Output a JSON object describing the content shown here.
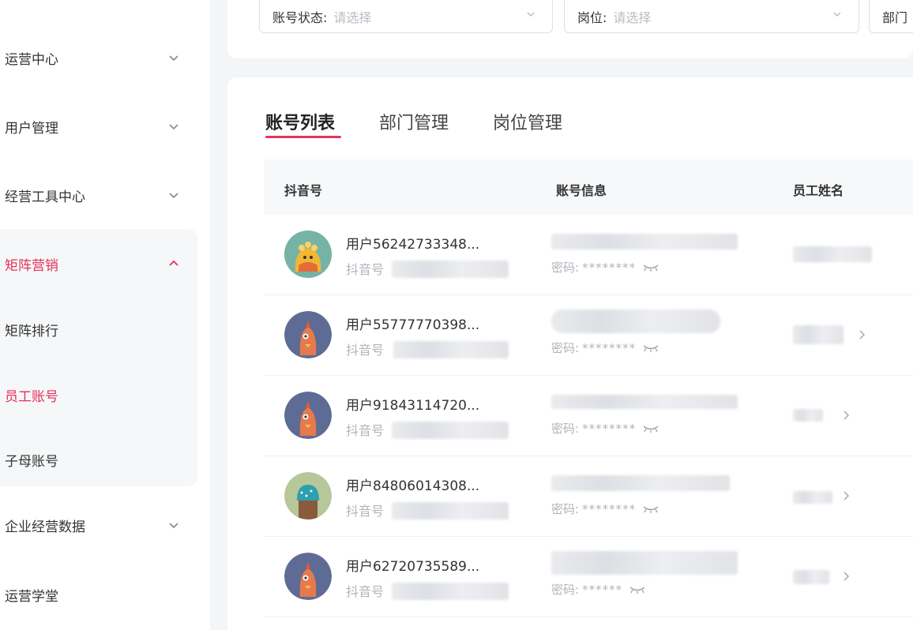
{
  "sidebar": {
    "items": [
      {
        "label": "运营中心"
      },
      {
        "label": "用户管理"
      },
      {
        "label": "经营工具中心"
      },
      {
        "label": "矩阵营销"
      },
      {
        "label": "矩阵排行"
      },
      {
        "label": "员工账号"
      },
      {
        "label": "子母账号"
      },
      {
        "label": "企业经营数据"
      },
      {
        "label": "运营学堂"
      }
    ]
  },
  "filters": {
    "account_status": {
      "label": "账号状态:",
      "placeholder": "请选择"
    },
    "position": {
      "label": "岗位:",
      "placeholder": "请选择"
    },
    "department": {
      "label": "部门"
    }
  },
  "tabs": [
    {
      "label": "账号列表"
    },
    {
      "label": "部门管理"
    },
    {
      "label": "岗位管理"
    }
  ],
  "table": {
    "headers": [
      "抖音号",
      "账号信息",
      "员工姓名"
    ],
    "rows": [
      {
        "name": "用户56242733348...",
        "douyin_label": "抖音号",
        "pwd_label": "密码:",
        "pwd": "********"
      },
      {
        "name": "用户55777770398...",
        "douyin_label": "抖音号",
        "pwd_label": "密码:",
        "pwd": "********"
      },
      {
        "name": "用户91843114720...",
        "douyin_label": "抖音号",
        "pwd_label": "密码:",
        "pwd": "********"
      },
      {
        "name": "用户84806014308...",
        "douyin_label": "抖音号",
        "pwd_label": "密码:",
        "pwd": "********"
      },
      {
        "name": "用户62720735589...",
        "douyin_label": "抖音号",
        "pwd_label": "密码:",
        "pwd": "******"
      }
    ]
  },
  "colors": {
    "accent": "#e5325b",
    "avatar_chick": "#5e6b95",
    "avatar_cactus": "#b6c79a",
    "avatar_yellow": "#76b3a5"
  }
}
